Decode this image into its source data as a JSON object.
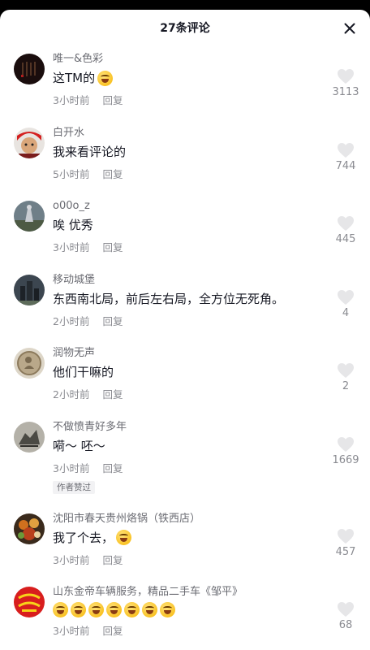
{
  "header": {
    "title": "27条评论",
    "close_icon": "close-icon"
  },
  "colors": {
    "text": "#161823",
    "secondary": "#8a8b91",
    "background": "#ffffff"
  },
  "comments": [
    {
      "user": "唯一&色彩",
      "text": "这TM的",
      "emoji_count": 1,
      "emoji": "laughing-tears-emoji",
      "time": "3小时前",
      "reply": "回复",
      "likes": "3113",
      "badge": ""
    },
    {
      "user": "白开水",
      "text": "我来看评论的",
      "emoji_count": 0,
      "time": "5小时前",
      "reply": "回复",
      "likes": "744",
      "badge": ""
    },
    {
      "user": "o00o_z",
      "text": "唉 优秀",
      "emoji_count": 0,
      "time": "3小时前",
      "reply": "回复",
      "likes": "445",
      "badge": ""
    },
    {
      "user": "移动城堡",
      "text": "东西南北局，前后左右局，全方位无死角。",
      "emoji_count": 0,
      "time": "2小时前",
      "reply": "回复",
      "likes": "4",
      "badge": ""
    },
    {
      "user": "润物无声",
      "text": "他们干嘛的",
      "emoji_count": 0,
      "time": "2小时前",
      "reply": "回复",
      "likes": "2",
      "badge": ""
    },
    {
      "user": "不做愤青好多年",
      "text": "嗬～ 呸～",
      "emoji_count": 0,
      "time": "3小时前",
      "reply": "回复",
      "likes": "1669",
      "badge": "作者赞过"
    },
    {
      "user": "沈阳市春天贵州烙锅（铁西店）",
      "text": "我了个去，",
      "emoji_count": 1,
      "emoji": "laughing-tears-emoji",
      "time": "3小时前",
      "reply": "回复",
      "likes": "457",
      "badge": ""
    },
    {
      "user": "山东金帝车辆服务，精品二手车《邹平》",
      "text": "",
      "emoji_count": 7,
      "emoji": "laughing-tears-emoji",
      "time": "3小时前",
      "reply": "回复",
      "likes": "68",
      "badge": ""
    }
  ]
}
